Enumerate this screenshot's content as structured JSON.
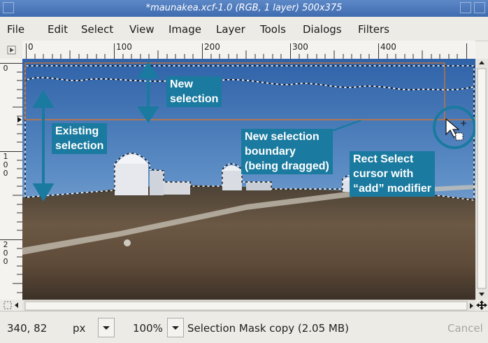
{
  "window": {
    "title": "*maunakea.xcf-1.0 (RGB, 1 layer) 500x375"
  },
  "menu": [
    "File",
    "Edit",
    "Select",
    "View",
    "Image",
    "Layer",
    "Tools",
    "Dialogs",
    "Filters"
  ],
  "ruler": {
    "h_labels": [
      "0",
      "100",
      "200",
      "300",
      "400"
    ],
    "v_labels": [
      [
        "0"
      ],
      [
        "1",
        "0",
        "0"
      ],
      [
        "2",
        "0",
        "0"
      ]
    ]
  },
  "annotations": {
    "new_selection": "New\nselection",
    "existing_selection": "Existing\nselection",
    "boundary": "New selection\nboundary\n(being dragged)",
    "cursor": "Rect Select\ncursor with\n“add” modifier"
  },
  "status": {
    "coords": "340, 82",
    "unit": "px",
    "zoom": "100%",
    "message": "Selection Mask copy (2.05 MB)",
    "cancel": "Cancel"
  },
  "colors": {
    "callout": "#1a7a9f",
    "titlebar": "#4a78bb"
  }
}
